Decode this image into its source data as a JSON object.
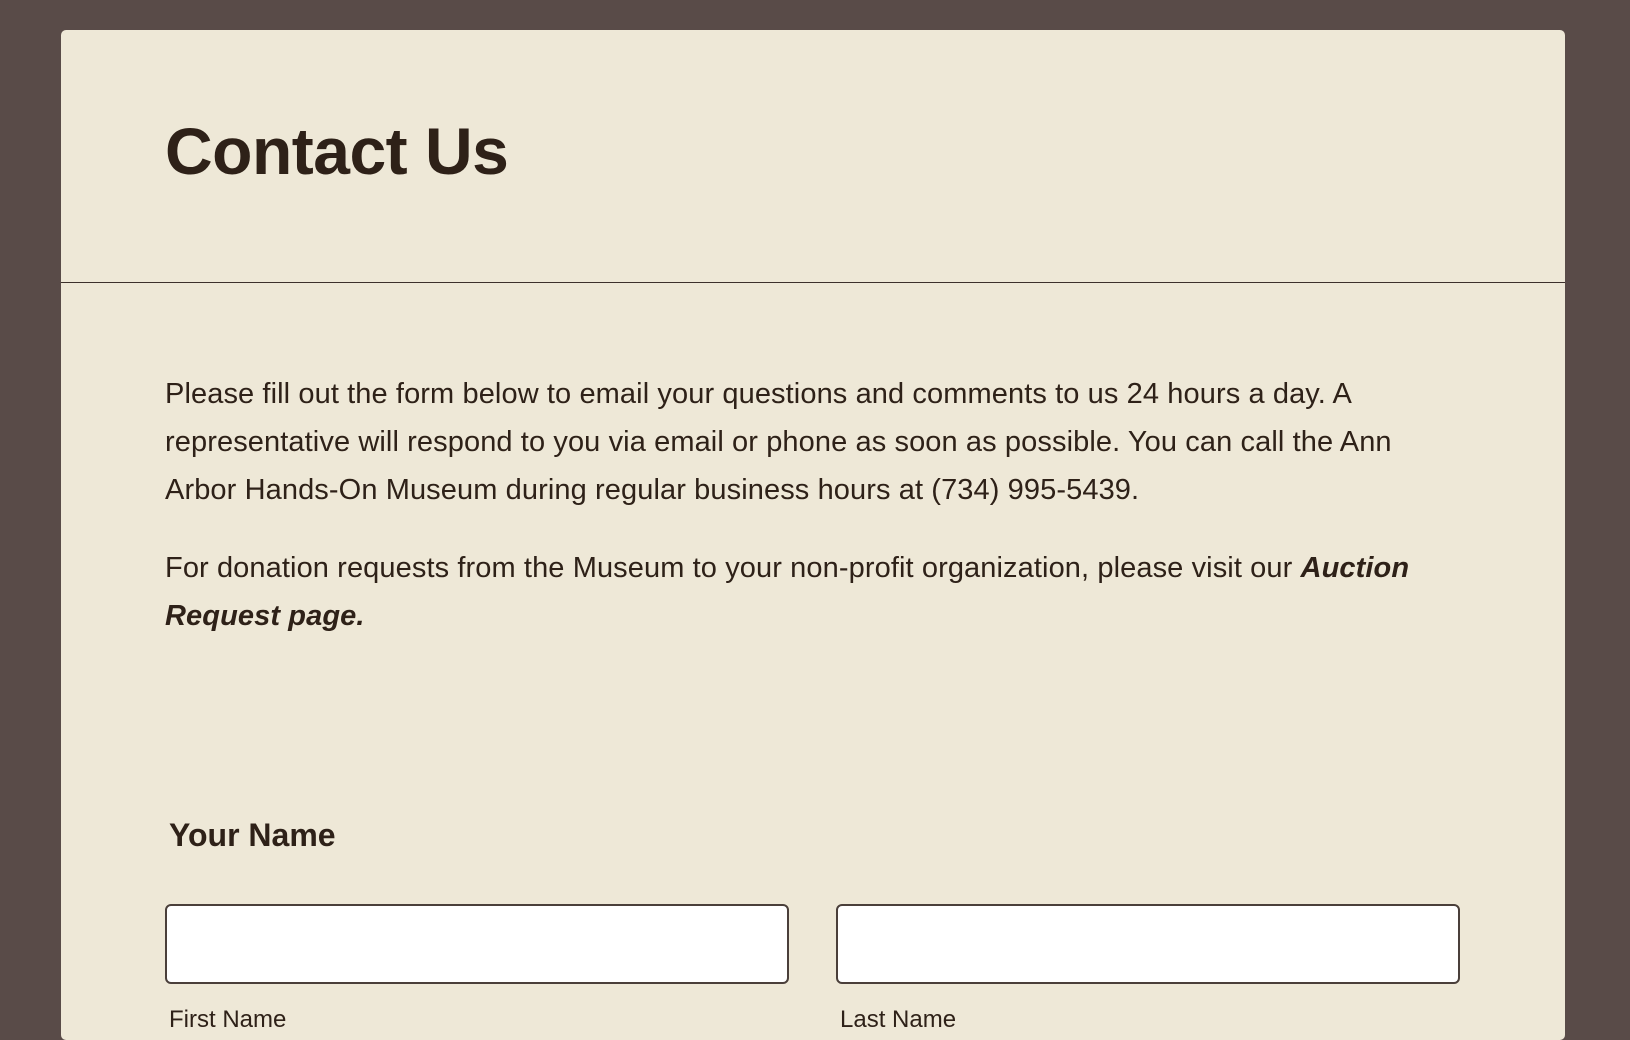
{
  "header": {
    "title": "Contact Us"
  },
  "content": {
    "intro_text": "Please fill out the form below to email your questions and comments to us 24 hours a day. A representative will respond to you via email or phone as soon as possible.  You can call the Ann Arbor Hands-On Museum during regular business hours at (734) 995-5439.",
    "donation_text": "For donation requests from the Museum to your non-profit organization, please visit our ",
    "auction_link_label": "Auction Request page."
  },
  "form": {
    "name_section_label": "Your Name",
    "first_name": {
      "value": "",
      "sublabel": "First Name"
    },
    "last_name": {
      "value": "",
      "sublabel": "Last Name"
    }
  },
  "colors": {
    "page_background": "#594b48",
    "card_background": "#eee8d7",
    "text": "#2e2118",
    "input_background": "#ffffff",
    "input_border": "#4a3f3a"
  }
}
